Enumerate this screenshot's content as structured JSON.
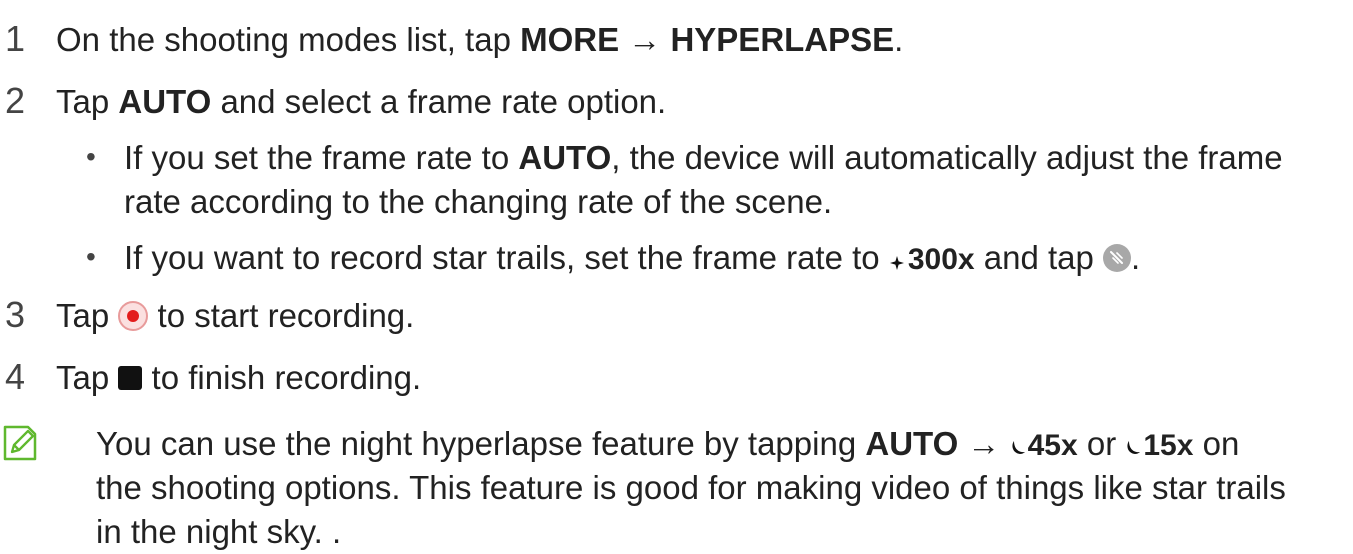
{
  "steps": [
    {
      "num": "1",
      "pre": "On the shooting modes list, tap ",
      "b1": "MORE",
      "arrow": " → ",
      "b2": "HYPERLAPSE",
      "post": "."
    },
    {
      "num": "2",
      "pre": "Tap ",
      "b1": "AUTO",
      "post": " and select a frame rate option."
    },
    {
      "num": "3",
      "pre": "Tap ",
      "post": " to start recording."
    },
    {
      "num": "4",
      "pre": "Tap ",
      "post": " to finish recording."
    }
  ],
  "bullets": [
    {
      "pre": "If you set the frame rate to ",
      "b1": "AUTO",
      "post": ", the device will automatically adjust the frame",
      "cont": "rate according to the changing rate of the scene."
    },
    {
      "pre": "If you want to record star trails, set the frame rate to ",
      "badge": "300x",
      "mid": " and tap ",
      "post": "."
    }
  ],
  "note": {
    "pre": "You can use the night hyperlapse feature by tapping ",
    "b1": "AUTO",
    "arrow": " → ",
    "badge1": "45x",
    "or": " or ",
    "badge2": "15x",
    "post": " on",
    "line2": "the shooting options. This feature is good for making video of things like star trails",
    "line3": "in the night sky. ."
  },
  "icons": [
    "star-sparkle-icon",
    "star-trail-icon",
    "record-icon",
    "stop-icon",
    "moon-icon",
    "note-pencil-icon"
  ],
  "colors": {
    "text": "#222222",
    "record_red": "#e31c1c",
    "note_green": "#5fb82e"
  }
}
